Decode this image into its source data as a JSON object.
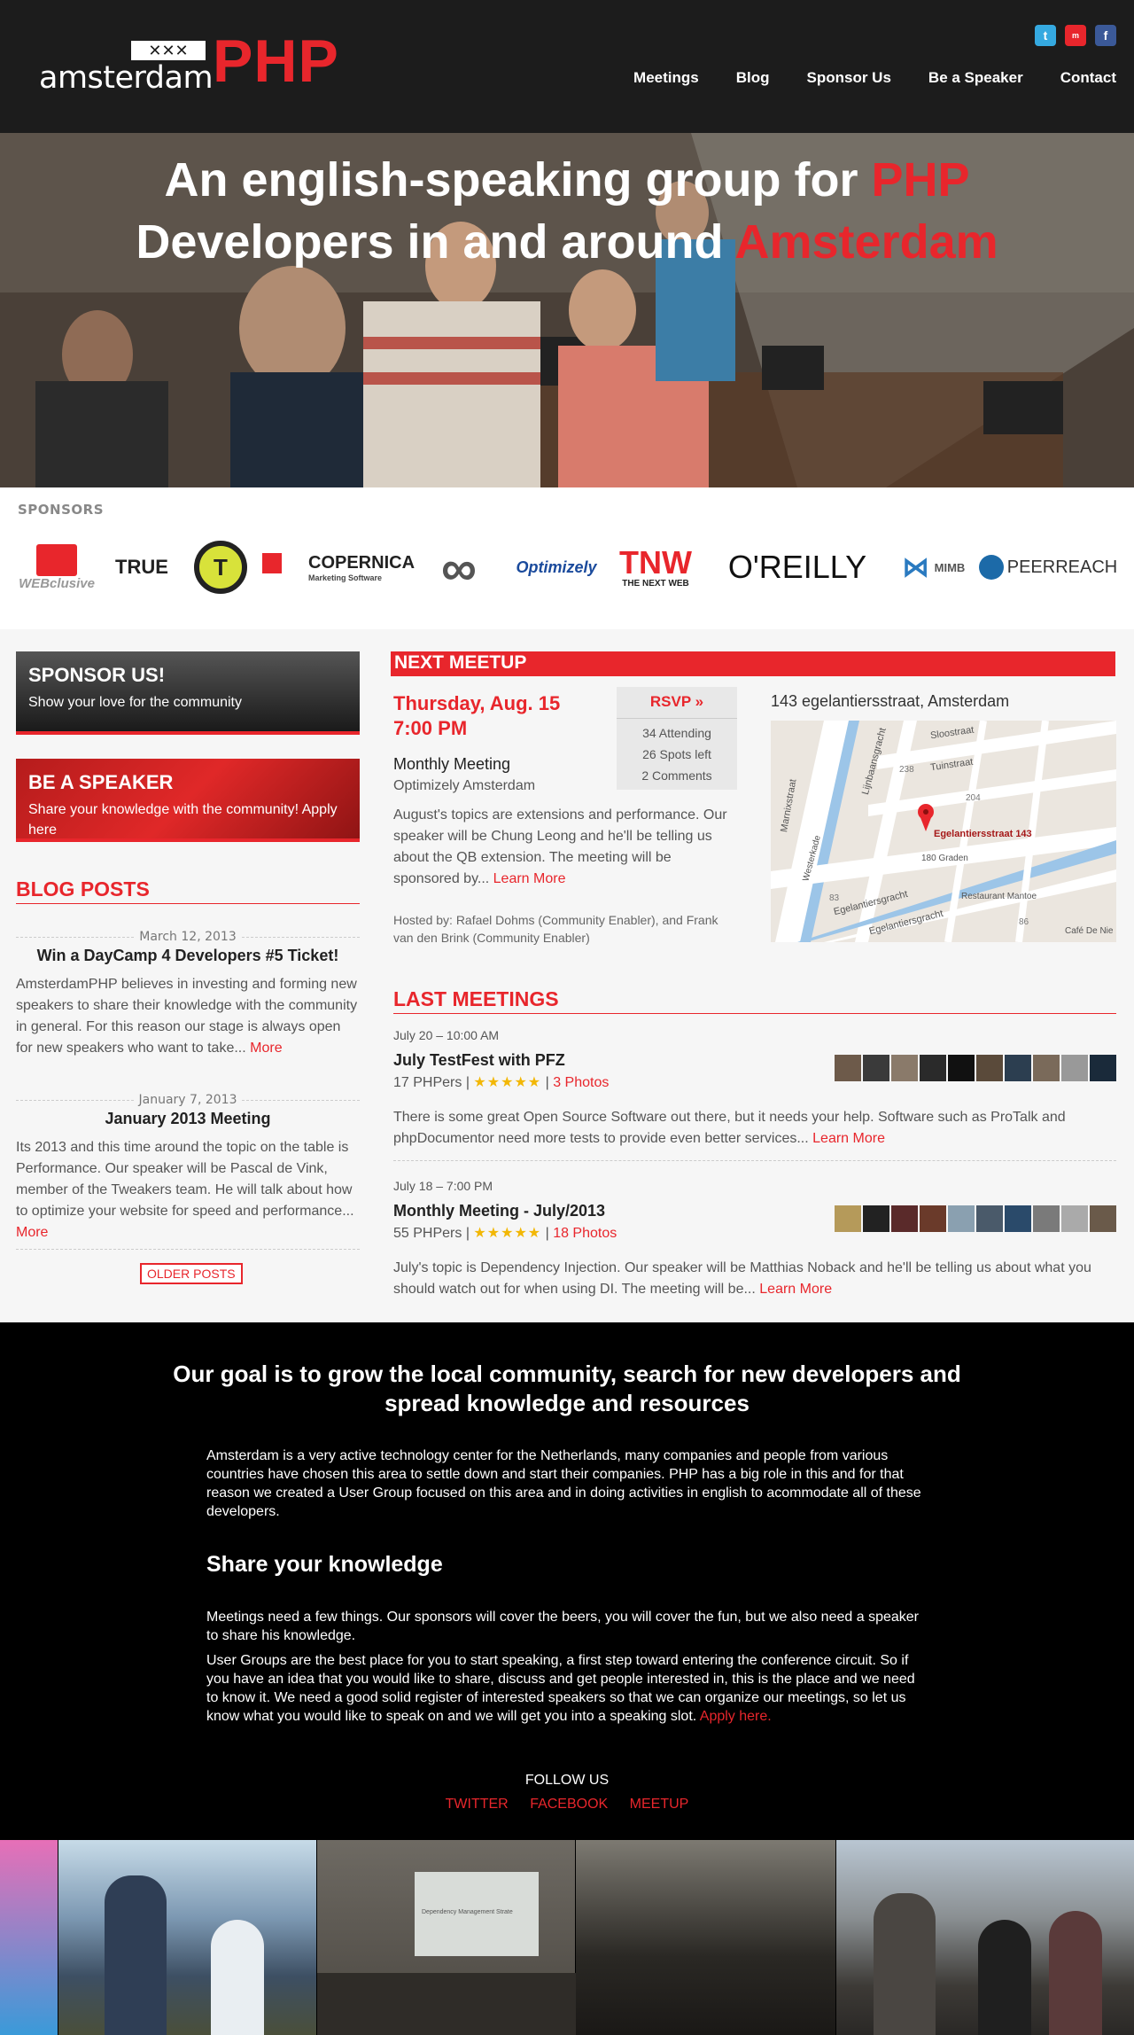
{
  "header": {
    "logo_x": "✕✕✕",
    "logo_city": "amsterdam",
    "logo_php": "PHP",
    "social": [
      "twitter-icon",
      "meetup-icon",
      "facebook-icon"
    ],
    "nav": [
      "Meetings",
      "Blog",
      "Sponsor Us",
      "Be a Speaker",
      "Contact"
    ]
  },
  "hero": {
    "line1_a": "An english-speaking group for ",
    "line1_b": "PHP",
    "line2_a": "Developers in and around ",
    "line2_b": "Amsterdam"
  },
  "sponsors": {
    "label": "SPONSORS",
    "items": [
      "WEBclusive",
      "TRUE",
      "T",
      "COPERNICA",
      "∞",
      "Optimizely",
      "TNW",
      "O'REILLY",
      "MIMB",
      "PEERREACH"
    ],
    "sub": {
      "copernica": "Marketing Software",
      "tnw": "THE NEXT WEB"
    }
  },
  "sidebar": {
    "sponsor_title": "SPONSOR US!",
    "sponsor_text": "Show your love for the community",
    "speaker_title": "BE A SPEAKER",
    "speaker_text": "Share your knowledge with the community! Apply here",
    "blog_title": "BLOG POSTS",
    "posts": [
      {
        "date": "March 12, 2013",
        "title": "Win a DayCamp 4 Developers #5 Ticket!",
        "body": "AmsterdamPHP believes in investing and forming new speakers to share their knowledge with the community in general. For this reason our stage is always open for new speakers who want to take... ",
        "more": "More"
      },
      {
        "date": "January 7, 2013",
        "title": "January 2013 Meeting",
        "body": "Its 2013 and this time around the topic on the table is Performance. Our speaker will be Pascal de Vink, member of the Tweakers team. He will talk about how to optimize your website for speed and performance... ",
        "more": "More"
      }
    ],
    "older": "OLDER POSTS"
  },
  "next_meetup": {
    "heading": "NEXT MEETUP",
    "date": "Thursday, Aug. 15",
    "time": "7:00 PM",
    "name": "Monthly Meeting",
    "venue": "Optimizely Amsterdam",
    "desc": "August's topics are extensions and performance. Our speaker will be Chung Leong and he'll be telling us about the QB extension. The meeting will be sponsored by... ",
    "learn_more": "Learn More",
    "host": "Hosted by: Rafael Dohms (Community Enabler), and Frank van den Brink (Community Enabler)",
    "rsvp": "RSVP »",
    "attending": "34 Attending",
    "spots": "26 Spots left",
    "comments": "2 Comments",
    "address": "143 egelantiersstraat, Amsterdam",
    "map": {
      "pin_label": "Egelantiersstraat 143",
      "streets": [
        "Sloostraat",
        "Tuinstraat",
        "Lijnbaansgracht",
        "Marnixstraat",
        "Westerkade",
        "Egelantiersgracht",
        "Egelantiersgracht",
        "Restaurant Mantoe",
        "Café De Nie",
        "180 Graden",
        "238",
        "204",
        "83",
        "86"
      ]
    }
  },
  "last_meetings": {
    "heading": "LAST MEETINGS",
    "items": [
      {
        "time": "July 20 – 10:00 AM",
        "title": "July TestFest with PFZ",
        "count": "17 PHPers | ",
        "stars": "★★★★★",
        "photos": "3 Photos",
        "body": "There is some great Open Source Software out there, but it needs your help. Software such as ProTalk and phpDocumentor need more tests to provide even better services... ",
        "learn_more": "Learn More"
      },
      {
        "time": "July 18 – 7:00 PM",
        "title": "Monthly Meeting - July/2013",
        "count": "55 PHPers | ",
        "stars": "★★★★★",
        "photos": "18 Photos",
        "body": "July's topic is Dependency Injection. Our speaker will be Matthias Noback and he'll be telling us about what you should watch out for when using DI. The meeting will be... ",
        "learn_more": "Learn More"
      }
    ]
  },
  "about": {
    "goal": "Our goal is to grow the local community, search for new developers and spread knowledge and resources",
    "p1": "Amsterdam is a very active technology center for the Netherlands, many companies and people from various countries have chosen this area to settle down and start their companies. PHP has a big role in this and for that reason we created a User Group focused on this area and in doing activities in english to acommodate all of these developers.",
    "share_heading": "Share your knowledge",
    "p2": "Meetings need a few things. Our sponsors will cover the beers, you will cover the fun, but we also need a speaker to share his knowledge.",
    "p3": "User Groups are the best place for you to start speaking, a first step toward entering the conference circuit. So if you have an idea that you would like to share, discuss and get people interested in, this is the place and we need to know it. We need a good solid register of interested speakers so that we can organize our meetings, so let us know what you would like to speak on and we will get you into a speaking slot. ",
    "apply": "Apply here.",
    "follow": "FOLLOW US",
    "links": [
      "TWITTER",
      "FACEBOOK",
      "MEETUP"
    ]
  },
  "slides_text": "Dependency Management Strate",
  "colors": {
    "accent": "#e8262c",
    "header": "#1c1c1c",
    "black": "#000000"
  }
}
